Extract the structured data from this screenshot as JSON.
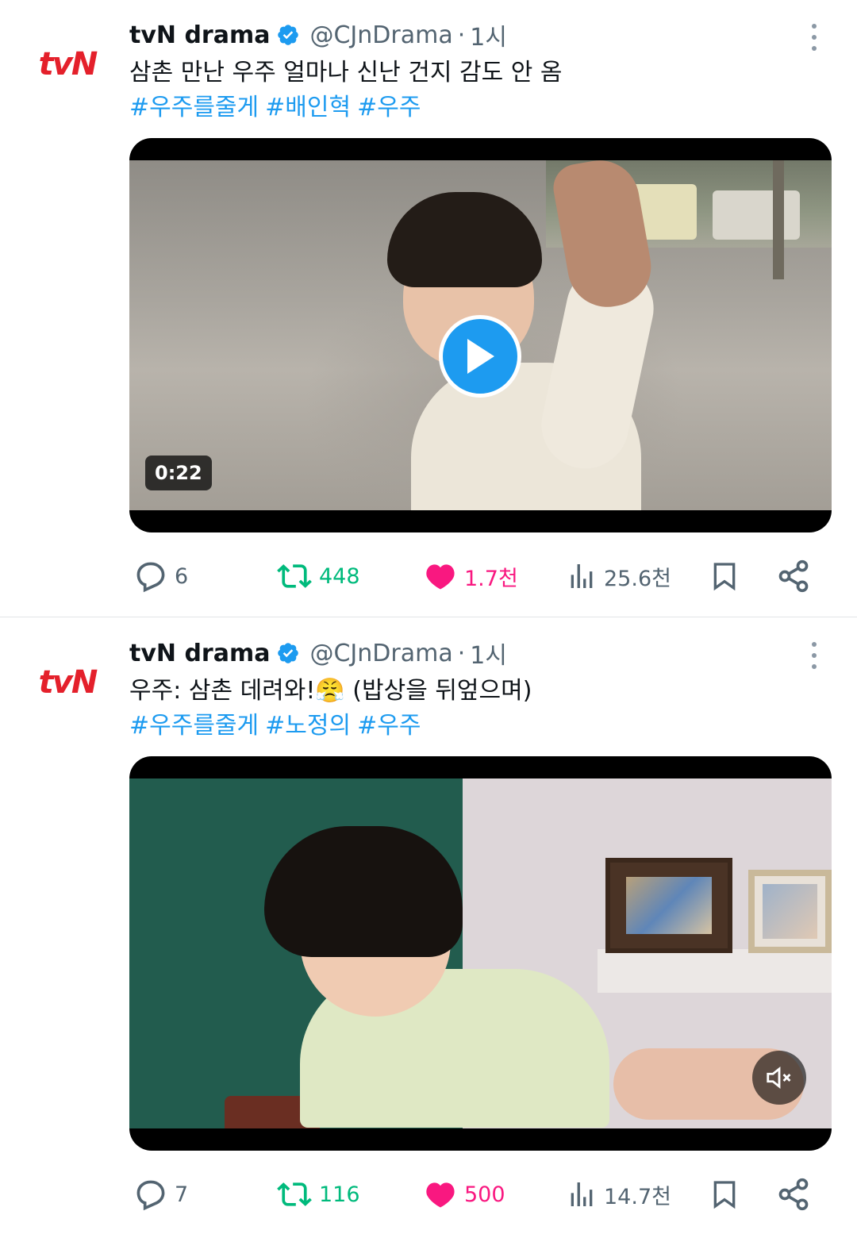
{
  "tweets": [
    {
      "avatar_text": "tvN",
      "name": "tvN drama",
      "handle": "@CJnDrama",
      "separator": "·",
      "time": "1시",
      "text": "삼촌 만난 우주 얼마나 신난 건지 감도 안 옴",
      "hashtags": [
        "#우주를줄게",
        "#배인혁",
        "#우주"
      ],
      "media": {
        "type": "video",
        "duration": "0:22",
        "state": "paused"
      },
      "stats": {
        "replies": "6",
        "retweets": "448",
        "likes": "1.7천",
        "views": "25.6천"
      }
    },
    {
      "avatar_text": "tvN",
      "name": "tvN drama",
      "handle": "@CJnDrama",
      "separator": "·",
      "time": "1시",
      "text": "우주: 삼촌 데려와!😤 (밥상을 뒤엎으며)",
      "hashtags": [
        "#우주를줄게",
        "#노정의",
        "#우주"
      ],
      "media": {
        "type": "video",
        "state": "playing-muted"
      },
      "stats": {
        "replies": "7",
        "retweets": "116",
        "likes": "500",
        "views": "14.7천"
      }
    }
  ],
  "colors": {
    "accent": "#1d9bf0",
    "retweet": "#00ba7c",
    "like": "#f91880",
    "muted": "#536471",
    "brand": "#e4202b"
  }
}
